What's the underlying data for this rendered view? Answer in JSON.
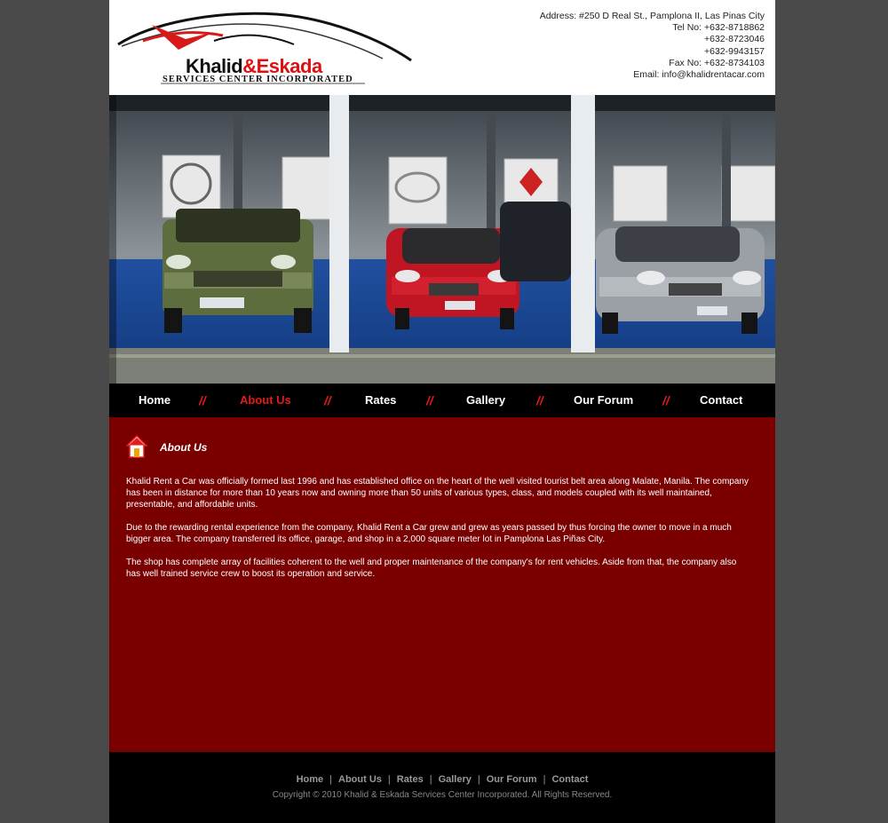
{
  "brand": {
    "name_part1": "Khalid",
    "name_amp": "&",
    "name_part2": "Eskada",
    "tagline": "SERVICES CENTER INCORPORATED"
  },
  "contact": {
    "address": "Address: #250 D Real St., Pamplona II, Las Pinas City",
    "tel": "Tel No: +632-8718862",
    "tel2": "+632-8723046",
    "tel3": "+632-9943157",
    "fax": "Fax No: +632-8734103",
    "email": "Email: info@khalidrentacar.com"
  },
  "nav": {
    "items": [
      "Home",
      "About Us",
      "Rates",
      "Gallery",
      "Our Forum",
      "Contact"
    ],
    "separator": "//",
    "active": "About Us"
  },
  "content": {
    "title": "About Us",
    "paragraphs": [
      "Khalid Rent a Car was officially formed last 1996 and has established office on the heart of the well visited tourist belt area along Malate, Manila. The company has been in distance for more than 10 years now and owning more than 50 units of various types, class, and models coupled with its well maintained, presentable, and affordable units.",
      "Due to the rewarding rental experience from the company, Khalid Rent a Car grew and grew as years passed by thus forcing the owner to move in a much bigger area. The company transferred its office, garage, and shop in a 2,000 square meter lot in Pamplona Las Piñas City.",
      "The shop has complete array of facilities coherent to the well and proper maintenance of the company's for rent vehicles. Aside from that, the company also has well trained service crew to boost its operation and service."
    ]
  },
  "footer": {
    "links": [
      "Home",
      "About Us",
      "Rates",
      "Gallery",
      "Our Forum",
      "Contact"
    ],
    "separator": "|",
    "copyright": "Copyright © 2010 Khalid & Eskada Services Center Incorporated.  All Rights Reserved."
  },
  "colors": {
    "content_bg": "#7a0000",
    "accent_red": "#e31b1b",
    "page_bg": "#4a4a4a"
  }
}
